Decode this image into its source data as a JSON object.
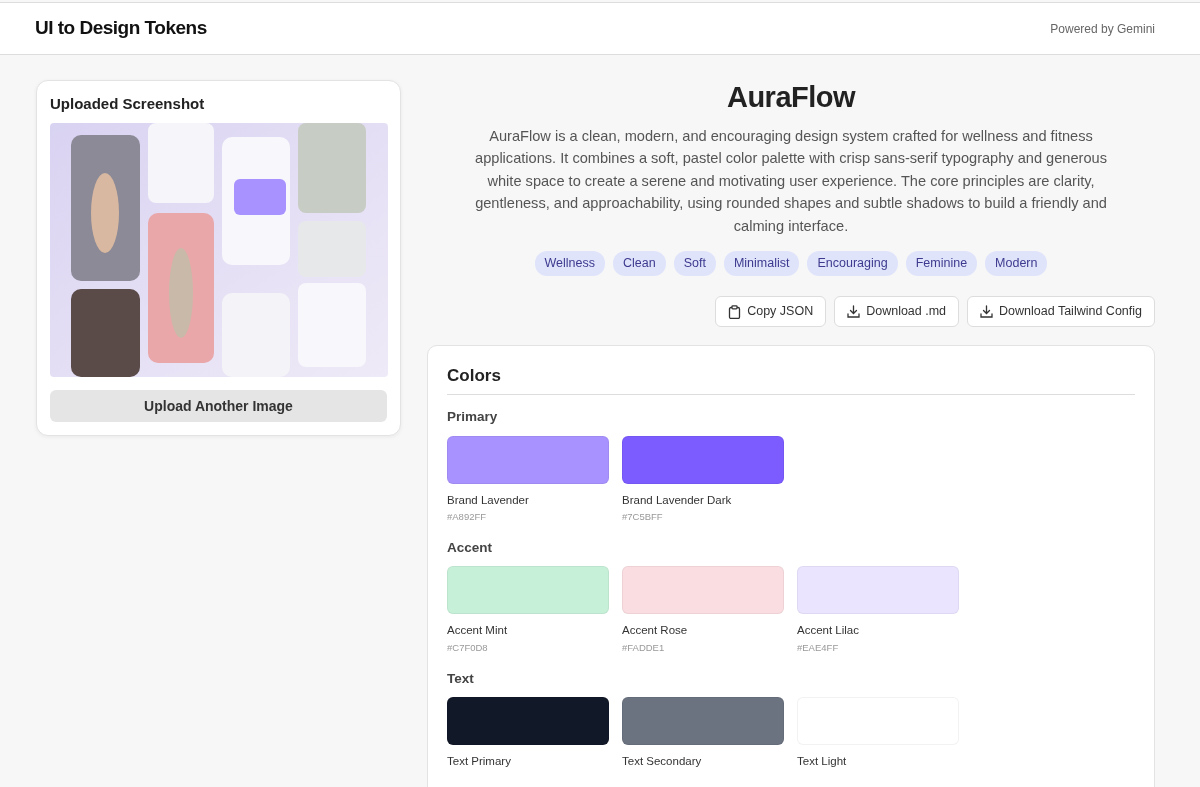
{
  "header": {
    "title": "UI to Design Tokens",
    "powered_by": "Powered by Gemini"
  },
  "upload": {
    "title": "Uploaded Screenshot",
    "button": "Upload Another Image"
  },
  "system": {
    "name": "AuraFlow",
    "description": "AuraFlow is a clean, modern, and encouraging design system crafted for wellness and fitness applications. It combines a soft, pastel color palette with crisp sans-serif typography and generous white space to create a serene and motivating user experience. The core principles are clarity, gentleness, and approachability, using rounded shapes and subtle shadows to build a friendly and calming interface.",
    "tags": [
      "Wellness",
      "Clean",
      "Soft",
      "Minimalist",
      "Encouraging",
      "Feminine",
      "Modern"
    ]
  },
  "actions": [
    {
      "kind": "copy",
      "label": "Copy JSON"
    },
    {
      "kind": "download",
      "label": "Download .md"
    },
    {
      "kind": "download",
      "label": "Download Tailwind Config"
    }
  ],
  "colors": {
    "title": "Colors",
    "groups": [
      {
        "name": "Primary",
        "swatches": [
          {
            "name": "Brand Lavender",
            "hex": "#A892FF",
            "color": "#a892ff"
          },
          {
            "name": "Brand Lavender Dark",
            "hex": "#7C5BFF",
            "color": "#7c5bff"
          }
        ]
      },
      {
        "name": "Accent",
        "swatches": [
          {
            "name": "Accent Mint",
            "hex": "#C7F0D8",
            "color": "#c7f0d8"
          },
          {
            "name": "Accent Rose",
            "hex": "#FADDE1",
            "color": "#fadde1"
          },
          {
            "name": "Accent Lilac",
            "hex": "#EAE4FF",
            "color": "#eae4ff"
          }
        ]
      },
      {
        "name": "Text",
        "swatches": [
          {
            "name": "Text Primary",
            "color": "#111827"
          },
          {
            "name": "Text Secondary",
            "color": "#6b7280"
          },
          {
            "name": "Text Light",
            "color": "#ffffff"
          }
        ]
      }
    ]
  }
}
